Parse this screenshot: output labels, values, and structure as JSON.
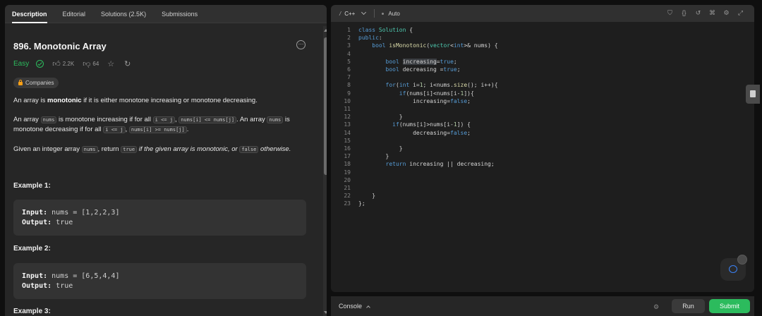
{
  "left": {
    "tabs": [
      "Description",
      "Editorial",
      "Solutions (2.5K)",
      "Submissions"
    ],
    "title": "896. Monotonic Array",
    "difficulty": "Easy",
    "likes": "2.2K",
    "dislikes": "64",
    "companies": "Companies",
    "para1_pre": "An array is ",
    "para1_bold": "monotonic",
    "para1_post": " if it is either monotone increasing or monotone decreasing.",
    "para2_a": "An array ",
    "para2_code1": "nums",
    "para2_b": " is monotone increasing if for all ",
    "para2_code2": "i <= j",
    "para2_c": ", ",
    "para2_code3": "nums[i] <= nums[j]",
    "para2_d": ". An array ",
    "para2_code4": "nums",
    "para2_e": " is monotone decreasing if for all ",
    "para2_code5": "i <= j",
    "para2_f": ", ",
    "para2_code6": "nums[i] >= nums[j]",
    "para2_g": ".",
    "para3_a": "Given an integer array ",
    "para3_code1": "nums",
    "para3_b": ", return ",
    "para3_code2": "true",
    "para3_c": " if the given array is monotonic, or ",
    "para3_code3": "false",
    "para3_d": " otherwise.",
    "example1_title": "Example 1:",
    "example1_input_label": "Input:",
    "example1_input": " nums = [1,2,2,3]",
    "example1_output_label": "Output:",
    "example1_output": " true",
    "example2_title": "Example 2:",
    "example2_input_label": "Input:",
    "example2_input": " nums = [6,5,4,4]",
    "example2_output_label": "Output:",
    "example2_output": " true",
    "example3_title": "Example 3:"
  },
  "editor": {
    "language": "C++",
    "mode": "Auto",
    "line_numbers": [
      "1",
      "2",
      "3",
      "4",
      "5",
      "6",
      "7",
      "8",
      "9",
      "10",
      "11",
      "12",
      "13",
      "14",
      "15",
      "16",
      "17",
      "18",
      "19",
      "20",
      "21",
      "22",
      "23"
    ]
  },
  "console": {
    "label": "Console",
    "run": "Run",
    "submit": "Submit"
  },
  "colors": {
    "accent_green": "#2cbb5d",
    "panel_bg": "#262626",
    "editor_bg": "#1e1e1e"
  }
}
